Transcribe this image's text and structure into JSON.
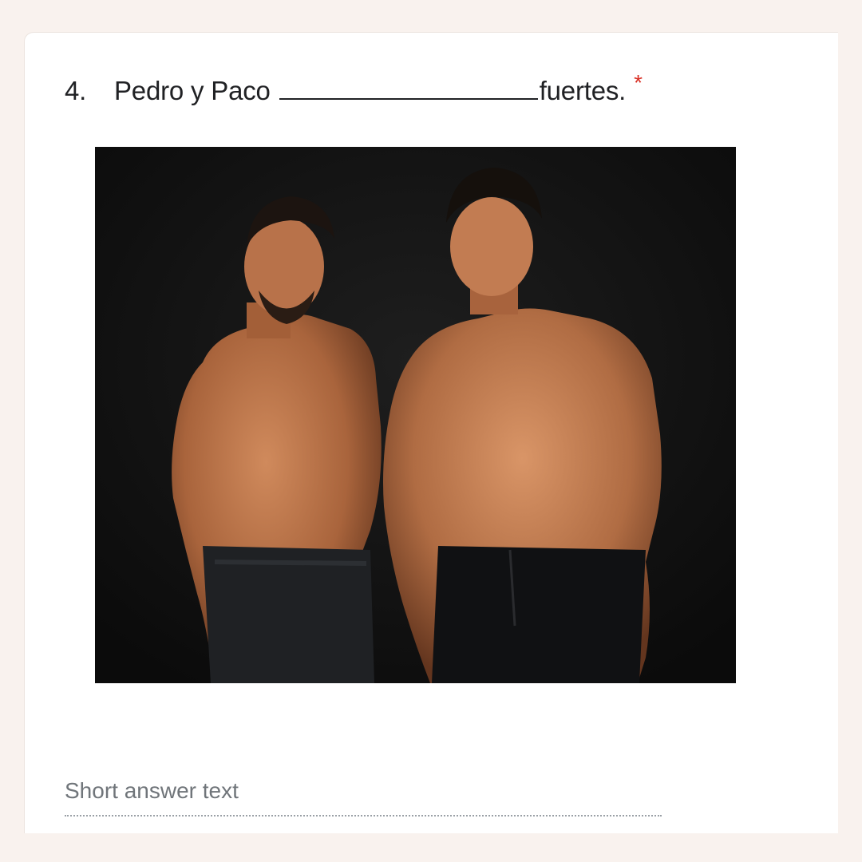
{
  "question": {
    "number": "4.",
    "text_before": "Pedro y Paco",
    "text_after": "fuertes.",
    "required_marker": "*"
  },
  "answer": {
    "placeholder": "Short answer text"
  },
  "colors": {
    "background": "#f9f2ee",
    "card": "#ffffff",
    "required": "#d93025",
    "placeholder": "#70757a"
  }
}
